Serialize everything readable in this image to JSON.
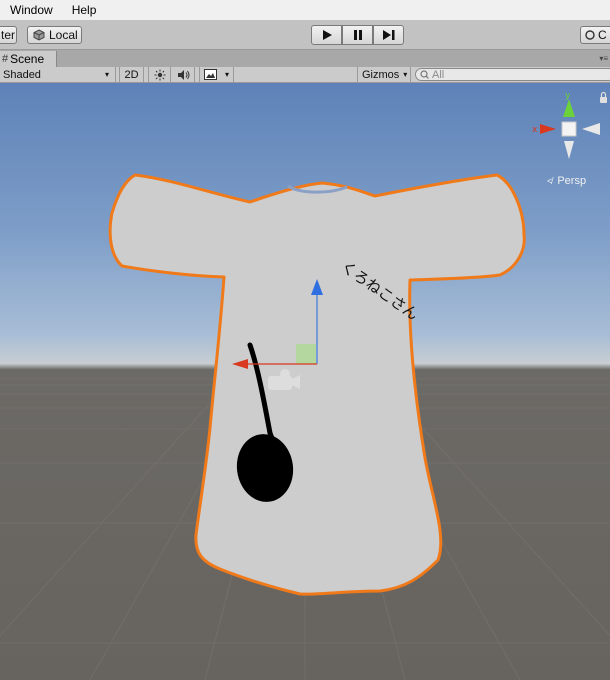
{
  "menu": {
    "items": [
      "Window",
      "Help"
    ]
  },
  "toolbar": {
    "pivot_label": "ter",
    "local_label": "Local",
    "collab_label": "C"
  },
  "scene_tab": {
    "label": "Scene"
  },
  "scene_toolbar": {
    "shading_mode": "Shaded",
    "twod_label": "2D",
    "gizmos_label": "Gizmos",
    "search_placeholder": "All"
  },
  "viewport": {
    "projection_label": "Persp",
    "shirt_text": "くろねこさん",
    "axis_labels": {
      "x": "x",
      "y": "y"
    }
  },
  "colors": {
    "selection_outline": "#f07a1a",
    "shirt_fill": "#cfcfcf",
    "x_axis": "#d8391f",
    "y_axis": "#6bd23a",
    "z_axis": "#3a78e0"
  }
}
